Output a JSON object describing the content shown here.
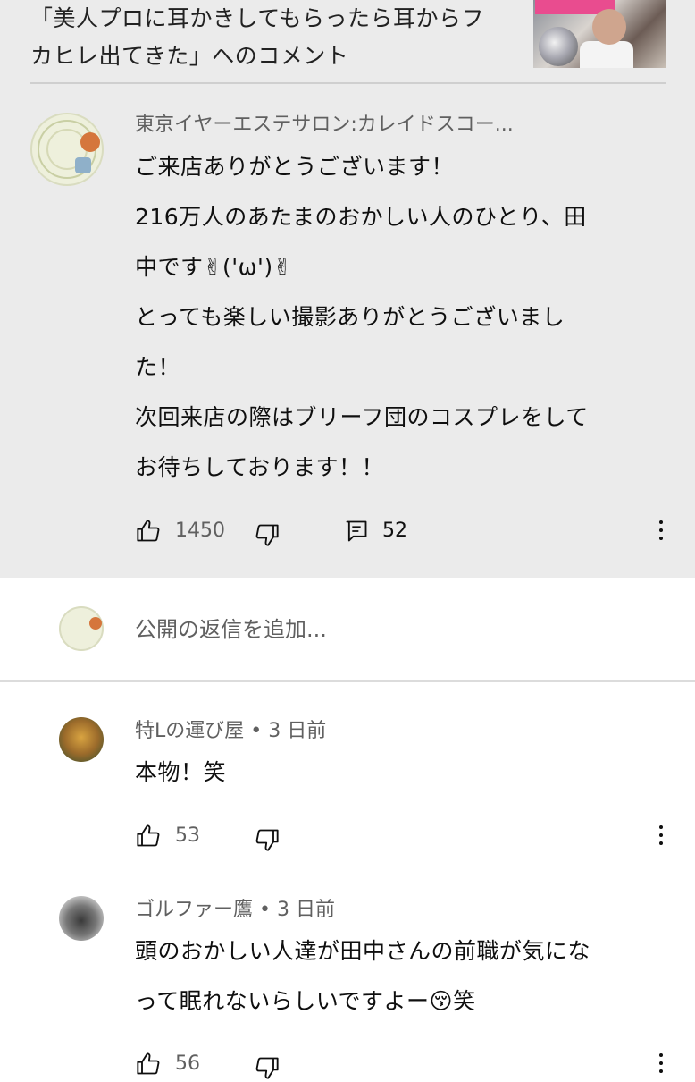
{
  "video": {
    "title_line1": "「美人プロに耳かきしてもらったら耳からフ",
    "title_line2": "カヒレ出てきた」へのコメント"
  },
  "main_comment": {
    "author": "東京イヤーエステサロン:カレイドスコー...",
    "lines": [
      "ご来店ありがとうございます！",
      "216万人のあたまのおかしい人のひとり、田",
      "中です✌('ω')✌",
      "とっても楽しい撮影ありがとうございまし",
      "た！",
      "次回来店の際はブリーフ団のコスプレをして",
      "お待ちしております！！"
    ],
    "likes": "1450",
    "replies_count": "52"
  },
  "reply_box": {
    "placeholder": "公開の返信を追加..."
  },
  "replies": [
    {
      "author": "特Lの運び屋 • 3 日前",
      "lines": [
        "本物！笑"
      ],
      "likes": "53"
    },
    {
      "author": "ゴルファー鷹 • 3 日前",
      "lines": [
        "頭のおかしい人達が田中さんの前職が気にな",
        "って眠れないらしいですよー😚笑"
      ],
      "likes": "56"
    }
  ],
  "colors": {
    "highlight_bg": "#ebebeb",
    "secondary_text": "#606060",
    "primary_text": "#0f0f0f"
  },
  "icons": {
    "like": "thumb-up-icon",
    "dislike": "thumb-down-icon",
    "reply": "comment-icon",
    "more": "more-vert-icon"
  }
}
